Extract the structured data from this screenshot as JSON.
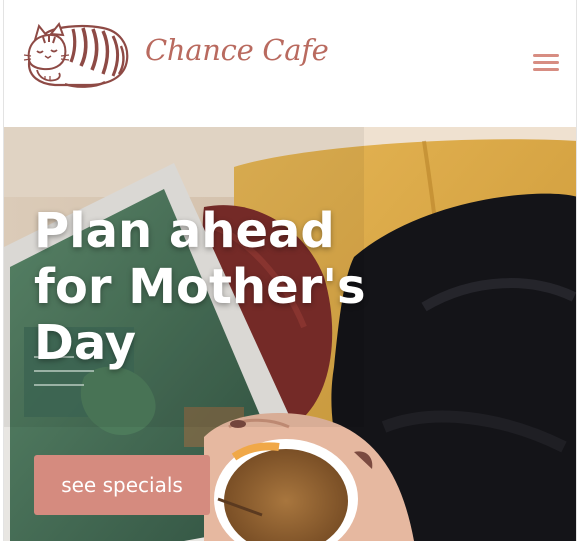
{
  "brand": {
    "name": "Chance Cafe",
    "accent_color": "#b96a5f",
    "logo_icon": "sleeping-cat-logo"
  },
  "header": {
    "menu_icon": "hamburger-menu-icon",
    "menu_color": "#d78d82"
  },
  "hero": {
    "heading_line1": "Plan ahead",
    "heading_line2": "for Mother's",
    "heading_line3": "Day",
    "cta_label": "see specials",
    "cta_color": "#d58b7f"
  }
}
